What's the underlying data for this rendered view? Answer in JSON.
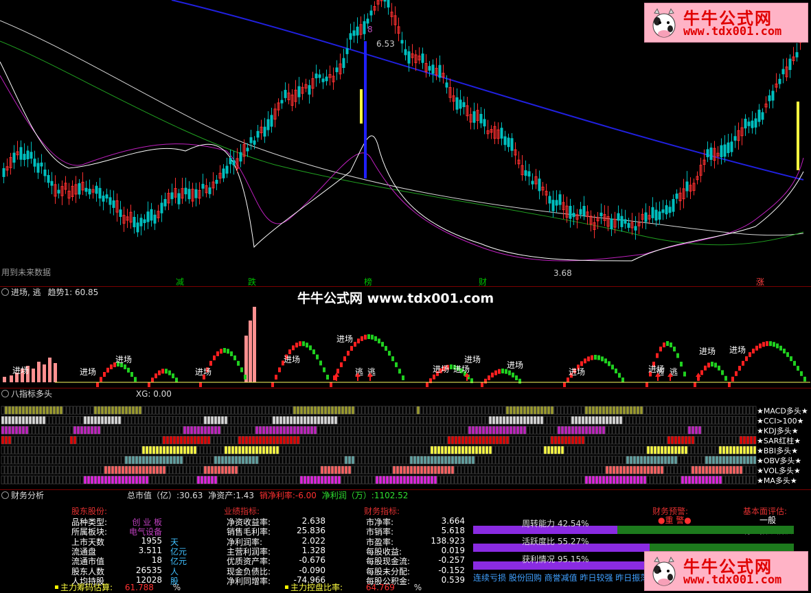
{
  "watermark_top": {
    "title": "牛牛公式网",
    "url": "www.tdx001.com"
  },
  "watermark_bottom": {
    "title": "牛牛公式网",
    "url": "www.tdx001.com"
  },
  "main_chart": {
    "note": "用到未来数据",
    "price_high": "6.53",
    "price_low": "3.68",
    "markers": [
      "减",
      "跌",
      "榜",
      "财",
      "涨"
    ],
    "peak_label": "8"
  },
  "signal_panel": {
    "title": "进场, 逃",
    "trend_label": "趋势1: 60.85",
    "center_watermark": "牛牛公式网 www.tdx001.com",
    "entry_label": "进场",
    "escape_label": "逃"
  },
  "indicator_panel": {
    "title": "八指标多头",
    "xg": "XG: 0.00",
    "rows": [
      {
        "name": "MACD多头",
        "color": "#9a9a2a"
      },
      {
        "name": "CCI>100",
        "color": "#d8d8d8"
      },
      {
        "name": "KDJ多头",
        "color": "#c020c0"
      },
      {
        "name": "SAR红柱",
        "color": "#e00000"
      },
      {
        "name": "BBI多头",
        "color": "#ffff40"
      },
      {
        "name": "OBV多头",
        "color": "#60a0a0"
      },
      {
        "name": "VOL多头",
        "color": "#ff6060"
      },
      {
        "name": "MA多头",
        "color": "#e020e0"
      }
    ]
  },
  "finance_header": {
    "title": "财务分析",
    "total_value_label": "总市值（亿）:",
    "total_value": "30.63",
    "net_assets_label": "净资产:",
    "net_assets": "1.43",
    "net_margin_label": "销净利率:",
    "net_margin": "-6.00",
    "net_profit_label": "净利润（万）:",
    "net_profit": "1102.52"
  },
  "finance": {
    "sec1_title": "股东股份:",
    "sec2_title": "业绩指标:",
    "sec3_title": "财务指标:",
    "sec4_title": "财务预警:",
    "sec5_title": "基本面评估:",
    "warning": "●重 警●",
    "evaluation": "一般",
    "evaluation_note": "有些指数偏低",
    "col1": [
      {
        "label": "品种类型:",
        "value": "创 业 板",
        "unit": ""
      },
      {
        "label": "所属板块:",
        "value": "电气设备",
        "unit": ""
      },
      {
        "label": "上市天数",
        "value": "1955",
        "unit": "天"
      },
      {
        "label": "流通盘",
        "value": "3.511",
        "unit": "亿元"
      },
      {
        "label": "流通市值",
        "value": "18",
        "unit": "亿元"
      },
      {
        "label": "股东人数",
        "value": "26535",
        "unit": "人"
      },
      {
        "label": "人均持股",
        "value": "12028",
        "unit": "股"
      }
    ],
    "col2": [
      {
        "label": "净资收益率:",
        "value": "2.638"
      },
      {
        "label": "销售毛利率:",
        "value": "25.836"
      },
      {
        "label": "净利润率:",
        "value": "2.022"
      },
      {
        "label": "主营利润率:",
        "value": "1.328"
      },
      {
        "label": "优质资产率:",
        "value": "-0.676"
      },
      {
        "label": "现金负债比:",
        "value": "-0.090"
      },
      {
        "label": "净利同增率:",
        "value": "-74.966"
      }
    ],
    "col3": [
      {
        "label": "市净率:",
        "value": "3.664"
      },
      {
        "label": "市销率:",
        "value": "5.618"
      },
      {
        "label": "市盈率:",
        "value": "138.923"
      },
      {
        "label": "每股收益:",
        "value": "0.019"
      },
      {
        "label": "每股现金流:",
        "value": "-0.257"
      },
      {
        "label": "每股未分配:",
        "value": "-0.152"
      },
      {
        "label": "每股公积金:",
        "value": "0.539"
      }
    ],
    "bars": [
      {
        "label": "周转能力",
        "value": "42.54%",
        "fill": 0.45
      },
      {
        "label": "活跃度比",
        "value": "55.27%",
        "fill": 0.55
      },
      {
        "label": "获利情况",
        "value": "95.15%",
        "fill": 0.95
      }
    ],
    "chip_label": "主力筹码估算:",
    "chip_value": "61.788",
    "chip_unit": "%",
    "control_label": "主力控盘比率:",
    "control_value": "64.769",
    "control_unit": "%",
    "ticker": "连续亏损 股份回购 商誉减值 昨日较强 昨日振荡"
  }
}
